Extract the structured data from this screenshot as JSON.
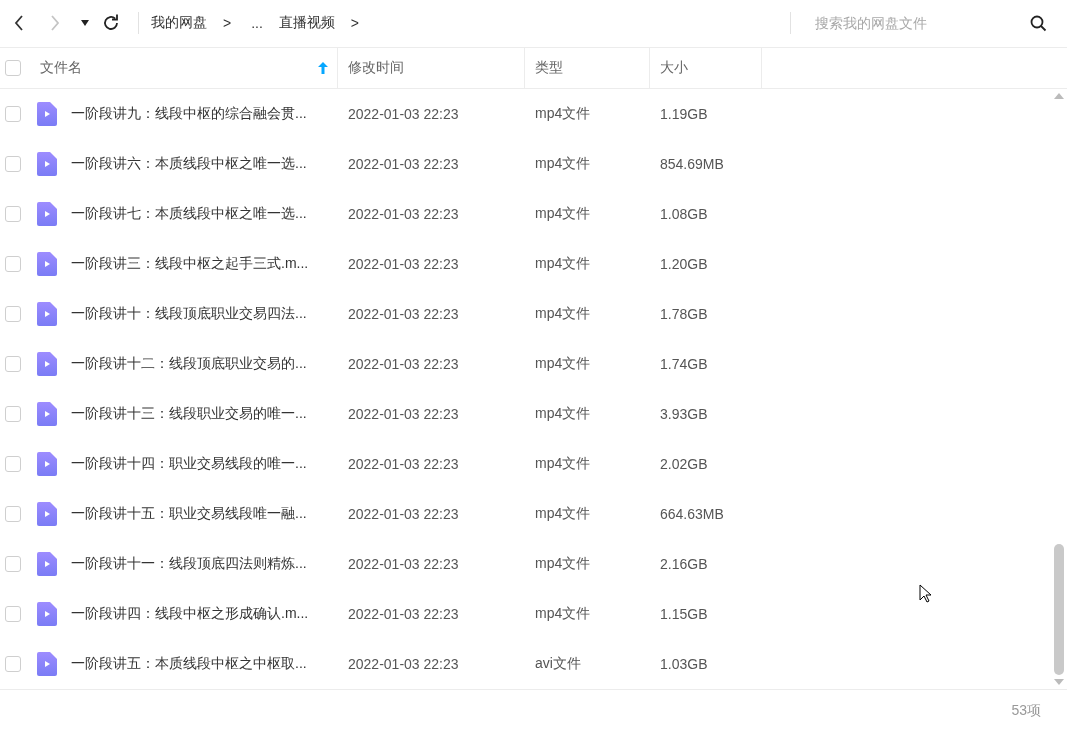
{
  "toolbar": {
    "breadcrumb": [
      {
        "label": "我的网盘"
      },
      {
        "label": "..."
      },
      {
        "label": "直播视频"
      }
    ],
    "separator": ">",
    "search": {
      "placeholder": "搜索我的网盘文件"
    }
  },
  "table": {
    "all_checked": false,
    "columns": [
      {
        "label": "文件名",
        "sorted": true
      },
      {
        "label": "修改时间",
        "sorted": false
      },
      {
        "label": "类型",
        "sorted": false
      },
      {
        "label": "大小",
        "sorted": false
      }
    ],
    "rows": [
      {
        "name": "一阶段讲九：线段中枢的综合融会贯...",
        "modified": "2022-01-03 22:23",
        "type": "mp4文件",
        "size": "1.19GB",
        "checked": false
      },
      {
        "name": "一阶段讲六：本质线段中枢之唯一选...",
        "modified": "2022-01-03 22:23",
        "type": "mp4文件",
        "size": "854.69MB",
        "checked": false
      },
      {
        "name": "一阶段讲七：本质线段中枢之唯一选...",
        "modified": "2022-01-03 22:23",
        "type": "mp4文件",
        "size": "1.08GB",
        "checked": false
      },
      {
        "name": "一阶段讲三：线段中枢之起手三式.m...",
        "modified": "2022-01-03 22:23",
        "type": "mp4文件",
        "size": "1.20GB",
        "checked": false
      },
      {
        "name": "一阶段讲十：线段顶底职业交易四法...",
        "modified": "2022-01-03 22:23",
        "type": "mp4文件",
        "size": "1.78GB",
        "checked": false
      },
      {
        "name": "一阶段讲十二：线段顶底职业交易的...",
        "modified": "2022-01-03 22:23",
        "type": "mp4文件",
        "size": "1.74GB",
        "checked": false
      },
      {
        "name": "一阶段讲十三：线段职业交易的唯一...",
        "modified": "2022-01-03 22:23",
        "type": "mp4文件",
        "size": "3.93GB",
        "checked": false
      },
      {
        "name": "一阶段讲十四：职业交易线段的唯一...",
        "modified": "2022-01-03 22:23",
        "type": "mp4文件",
        "size": "2.02GB",
        "checked": false
      },
      {
        "name": "一阶段讲十五：职业交易线段唯一融...",
        "modified": "2022-01-03 22:23",
        "type": "mp4文件",
        "size": "664.63MB",
        "checked": false
      },
      {
        "name": "一阶段讲十一：线段顶底四法则精炼...",
        "modified": "2022-01-03 22:23",
        "type": "mp4文件",
        "size": "2.16GB",
        "checked": false
      },
      {
        "name": "一阶段讲四：线段中枢之形成确认.m...",
        "modified": "2022-01-03 22:23",
        "type": "mp4文件",
        "size": "1.15GB",
        "checked": false
      },
      {
        "name": "一阶段讲五：本质线段中枢之中枢取...",
        "modified": "2022-01-03 22:23",
        "type": "avi文件",
        "size": "1.03GB",
        "checked": false
      }
    ]
  },
  "status_bar": {
    "count": "53项"
  }
}
